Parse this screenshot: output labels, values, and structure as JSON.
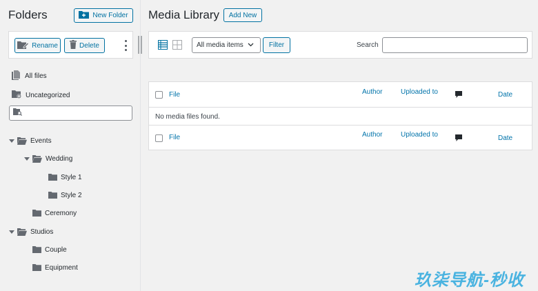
{
  "sidebar": {
    "title": "Folders",
    "new_folder_label": "New Folder",
    "rename_label": "Rename",
    "delete_label": "Delete",
    "all_files_label": "All files",
    "uncategorized_label": "Uncategorized",
    "search_value": "",
    "tree": {
      "events": "Events",
      "wedding": "Wedding",
      "style1": "Style 1",
      "style2": "Style 2",
      "ceremony": "Ceremony",
      "studios": "Studios",
      "couple": "Couple",
      "equipment": "Equipment"
    }
  },
  "main": {
    "title": "Media Library",
    "add_new_label": "Add New",
    "filter": {
      "media_select_value": "All media items",
      "filter_button": "Filter",
      "search_label": "Search",
      "search_value": ""
    },
    "table": {
      "columns": {
        "file": "File",
        "author": "Author",
        "uploaded_to": "Uploaded to",
        "comments_icon": "comment-icon",
        "date": "Date"
      },
      "empty_message": "No media files found."
    }
  },
  "watermark": "玖柒导航-秒收",
  "colors": {
    "accent": "#0071a1",
    "link": "#0073aa",
    "background": "#f1f1f1",
    "watermark": "#4ab3e0"
  }
}
